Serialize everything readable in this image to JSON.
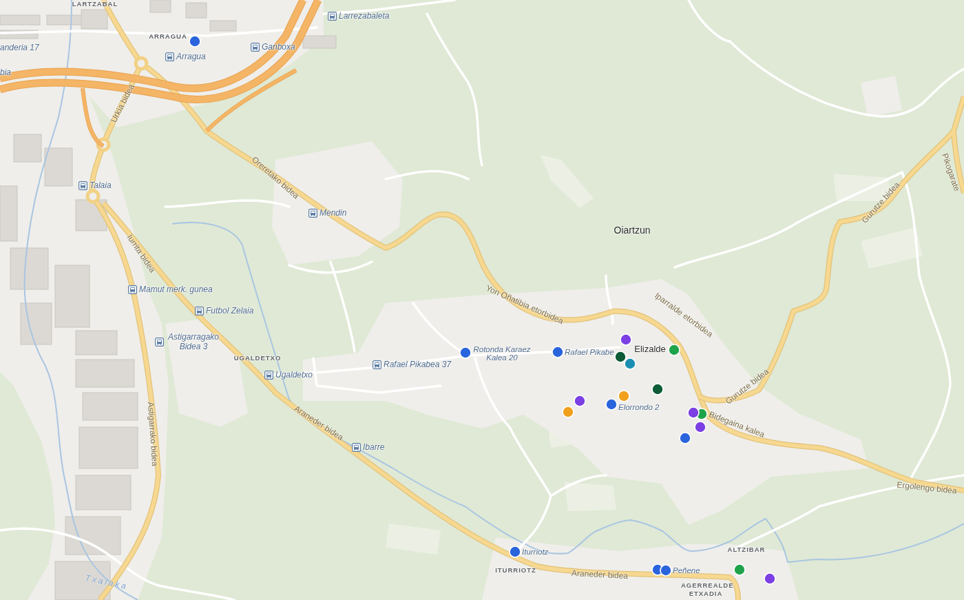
{
  "map": {
    "districts": [
      "LARTZABAL",
      "ARRAGUA",
      "UGALDETXO",
      "ITURRIOTZ",
      "ALTZIBAR",
      "AGERREALDE ETXADIA"
    ],
    "places": [
      "Oiartzun",
      "Elizalde"
    ],
    "edge_labels": [
      "anderia 17",
      "bia"
    ],
    "bus_stops": [
      "Larrezabaleta",
      "Ganboxa",
      "Arragua",
      "Talaia",
      "Mendin",
      "Mamut merk. gunea",
      "Futbol Zelaia",
      "Astigarragako Bidea 3",
      "Ugaldetxo",
      "Rafael Pikabea 37",
      "Ibarre"
    ],
    "streets": [
      "Urkia bidea",
      "Pikogarate",
      "Oreretako bidea",
      "Gurutze bidea",
      "Iurrita bidea",
      "Yon Oñatibia etorbidea",
      "Iparralde etorbidea",
      "Gurutze bidea",
      "Araneder bidea",
      "Bidegaina kalea",
      "Astigarrako bidea",
      "Ergolengo bidea",
      "Araneder bidea"
    ],
    "river": "Txalaka"
  },
  "markers": [
    {
      "color": "#2a64dc"
    },
    {
      "color": "#7b3fe4"
    },
    {
      "color": "#2a64dc",
      "label": "Rotonda Karaez Kalea 20"
    },
    {
      "color": "#2a64dc",
      "label": "Rafael Pikabe"
    },
    {
      "color": "#1fa34a"
    },
    {
      "color": "#0d5c36"
    },
    {
      "color": "#1b8fb3"
    },
    {
      "color": "#0d5c36"
    },
    {
      "color": "#f0a01c"
    },
    {
      "color": "#7b3fe4"
    },
    {
      "color": "#2a64dc",
      "label": "Elorrondo 2"
    },
    {
      "color": "#f0a01c"
    },
    {
      "color": "#1fa34a"
    },
    {
      "color": "#7b3fe4"
    },
    {
      "color": "#7b3fe4"
    },
    {
      "color": "#2a64dc"
    },
    {
      "color": "#2a64dc",
      "label": "Iturriotz"
    },
    {
      "color": "#2a64dc"
    },
    {
      "color": "#2a64dc",
      "label": "Peñene"
    },
    {
      "color": "#1fa34a"
    },
    {
      "color": "#7b3fe4"
    }
  ]
}
